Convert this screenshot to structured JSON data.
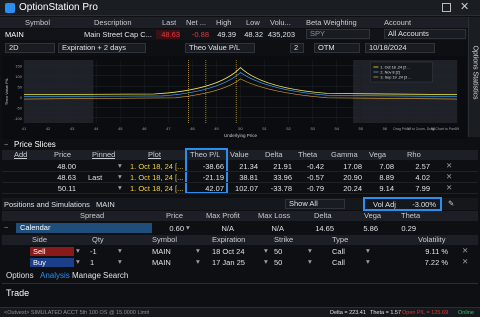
{
  "app": {
    "title": "OptionStation Pro"
  },
  "quote": {
    "headers": {
      "symbol": "Symbol",
      "description": "Description",
      "last": "Last",
      "net": "Net ...",
      "high": "High",
      "low": "Low",
      "volume": "Volu...",
      "beta": "Beta Weighting",
      "account": "Account"
    },
    "symbol": "MAIN",
    "description": "Main Street Cap C...",
    "last": "48.63",
    "net": "-0.88",
    "high": "49.39",
    "low": "48.32",
    "volume": "435,203",
    "beta": "SPY",
    "account": "All Accounts"
  },
  "toolbar": {
    "days": "2D",
    "expiration": "Expiration + 2 days",
    "theo": "Theo Value P/L",
    "count": "2",
    "otm": "OTM",
    "date": "10/18/2024"
  },
  "graph": {
    "x_label": "Underlying Price",
    "y_label": "Theo Value P/L",
    "x_ticks": [
      "41",
      "42",
      "43",
      "44",
      "45",
      "46",
      "47",
      "48",
      "49",
      "50",
      "51",
      "52",
      "53",
      "54",
      "55",
      "56",
      "57",
      "58",
      "59"
    ],
    "y_ticks": [
      "150",
      "100",
      "50",
      "0",
      "-50",
      "-100"
    ],
    "legend": [
      "1. Oct 18 ,24 [2 ..",
      "2. Nov 8 [2]",
      "3. Sep 19 ,24 [3 ..."
    ],
    "hint": "Drag Pricer to Zoom, Drag Chart to Pan",
    "colors": {
      "line1": "#f2e84a",
      "line2": "#3fa0ff",
      "line3": "#e0a030"
    }
  },
  "side_tab": "Options Statistics",
  "price_slices": {
    "title": "Price Slices",
    "headers": {
      "add": "Add",
      "price": "Price",
      "pinned": "Pinned",
      "plot": "Plot",
      "theo": "Theo P/L",
      "value": "Value",
      "delta": "Delta",
      "theta": "Theta",
      "gamma": "Gamma",
      "vega": "Vega",
      "rho": "Rho"
    },
    "rows": [
      {
        "price": "48.00",
        "pinned": "",
        "plot": "1. Oct 18, 24 [...",
        "theo": "-38.66",
        "value": "21.34",
        "delta": "21.91",
        "theta": "-0.42",
        "gamma": "17.08",
        "vega": "7.08",
        "rho": "2.57"
      },
      {
        "price": "48.63",
        "pinned": "Last",
        "plot": "1. Oct 18, 24 [...",
        "theo": "-21.19",
        "value": "38.81",
        "delta": "33.96",
        "theta": "-0.57",
        "gamma": "20.90",
        "vega": "8.89",
        "rho": "4.02"
      },
      {
        "price": "50.11",
        "pinned": "",
        "plot": "1. Oct 18, 24 [...",
        "theo": "42.07",
        "value": "102.07",
        "delta": "-33.78",
        "theta": "-0.79",
        "gamma": "20.24",
        "vega": "9.14",
        "rho": "7.99"
      }
    ]
  },
  "positions": {
    "title": "Positions and Simulations",
    "symbol": "MAIN",
    "filter": "Show All",
    "vol_adj_label": "Vol Adj",
    "vol_adj_value": "-3.00%",
    "headers": {
      "spread": "Spread",
      "price": "Price",
      "max_profit": "Max Profit",
      "max_loss": "Max Loss",
      "delta": "Delta",
      "vega": "Vega",
      "theta": "Theta"
    },
    "spread": {
      "name": "Calendar",
      "price": "0.60",
      "max_profit": "N/A",
      "max_loss": "N/A",
      "delta": "14.65",
      "vega": "5.86",
      "theta": "0.29"
    },
    "leg_headers": {
      "side": "Side",
      "qty": "Qty",
      "symbol": "Symbol",
      "expiration": "Expiration",
      "strike": "Strike",
      "type": "Type",
      "volatility": "Volatility"
    },
    "legs": [
      {
        "side": "Sell",
        "qty": "-1",
        "symbol": "MAIN",
        "expiration": "18 Oct 24",
        "strike": "50",
        "type": "Call",
        "volatility": "9.11 %"
      },
      {
        "side": "Buy",
        "qty": "1",
        "symbol": "MAIN",
        "expiration": "17 Jan 25",
        "strike": "50",
        "type": "Call",
        "volatility": "7.22 %"
      }
    ]
  },
  "tabs": [
    "Options",
    "Analysis",
    "Manage",
    "Search"
  ],
  "trade": "Trade",
  "status": {
    "left": "<Outvest> SIMULATED ACCT 5th 100 OS @ 15.0000 Limit",
    "delta": "Delta = 223.41",
    "theta": "Theta = 1.57",
    "open_pl": "Open P/L = 125.69",
    "online": "Online"
  }
}
